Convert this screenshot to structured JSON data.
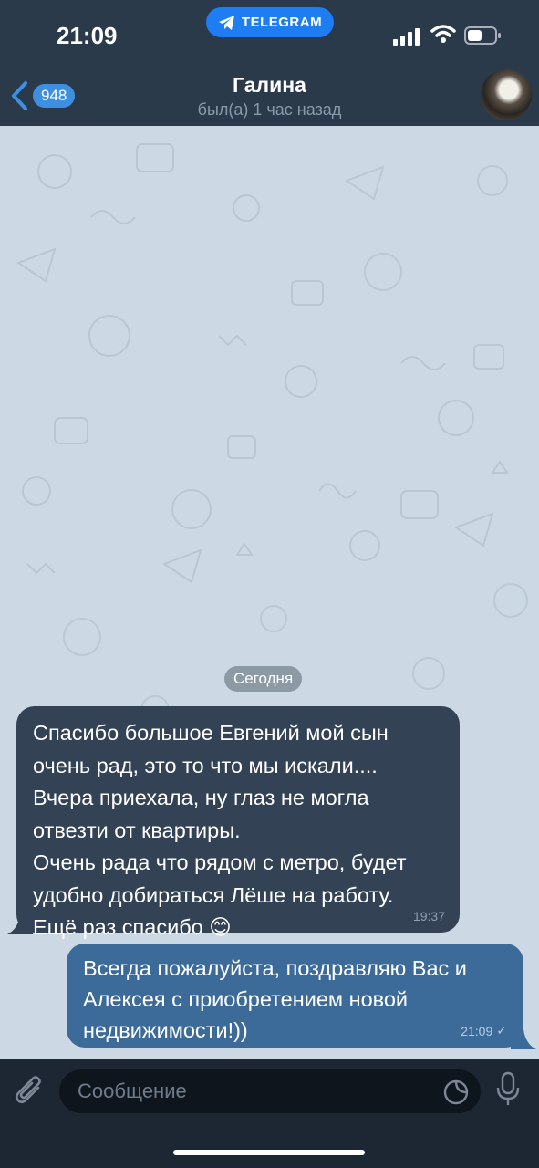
{
  "status_bar": {
    "time": "21:09",
    "app_pill": "TELEGRAM"
  },
  "header": {
    "back_badge": "948",
    "title": "Галина",
    "subtitle": "был(а) 1 час назад"
  },
  "chat": {
    "date_divider": "Сегодня",
    "messages": [
      {
        "direction": "incoming",
        "text": "Спасибо большое Евгений мой сын\nочень рад, это то что мы искали....\nВчера приехала, ну глаз не могла\nотвезти от квартиры.\nОчень рада что рядом с метро, будет\nудобно добираться Лёше на работу.\nЕщё раз спасибо 😊",
        "time": "19:37"
      },
      {
        "direction": "outgoing",
        "text": "Всегда пожалуйста, поздравляю Вас и\nАлексея с приобретением новой\nнедвижимости!))",
        "time": "21:09",
        "status": "✓"
      }
    ]
  },
  "composer": {
    "placeholder": "Сообщение"
  },
  "colors": {
    "header_bg": "#2b3a4b",
    "chat_bg": "#ccd9e4",
    "incoming_bubble": "#334254",
    "outgoing_bubble": "#3c6a99",
    "accent": "#1e7df2"
  },
  "icons": [
    "telegram-icon",
    "signal-icon",
    "wifi-icon",
    "battery-icon",
    "back-chevron-icon",
    "attach-icon",
    "sticker-icon",
    "mic-icon",
    "check-icon"
  ]
}
